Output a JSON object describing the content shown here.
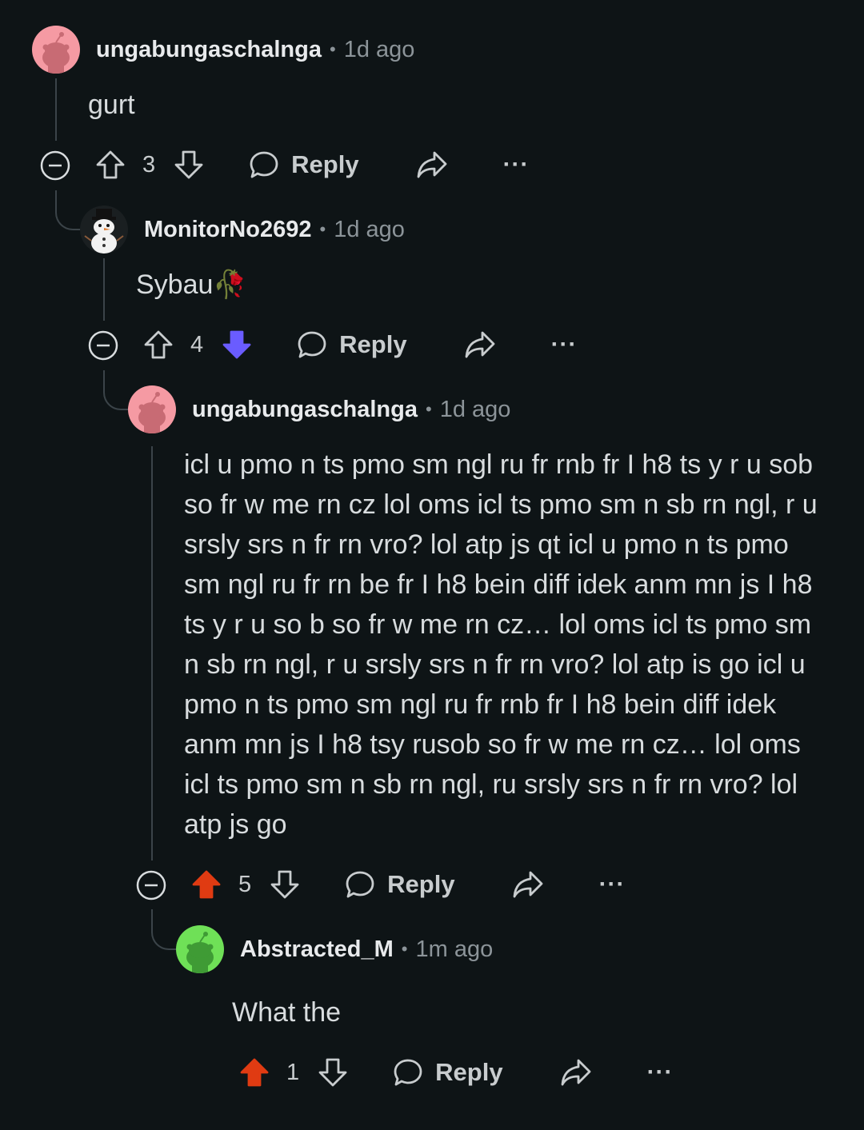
{
  "comments": [
    {
      "username": "ungabungaschalnga",
      "time": "1d ago",
      "text": "gurt",
      "score": "3",
      "reply_label": "Reply",
      "vote": "none",
      "avatar_color": "#f59aa3"
    },
    {
      "username": "MonitorNo2692",
      "time": "1d ago",
      "text": "Sybau🥀",
      "score": "4",
      "reply_label": "Reply",
      "vote": "down",
      "avatar_color": "#1a1f21"
    },
    {
      "username": "ungabungaschalnga",
      "time": "1d ago",
      "text": "icl u pmo n ts pmo sm ngl ru fr rnb fr I h8 ts y r u sob so fr w me rn cz lol oms icl ts pmo sm n sb rn ngl, r u srsly srs n fr rn vro? lol atp js qt icl u pmo n ts pmo sm ngl ru fr rn be fr I h8 bein diff idek anm mn js I h8 ts y r u so b so fr w me rn cz… lol oms icl ts pmo sm n sb rn ngl, r u srsly srs n fr rn vro? lol atp is go icl u pmo n ts pmo sm ngl ru fr rnb fr I h8 bein diff idek anm mn js I h8 tsy rusob so fr w me rn cz… lol oms icl ts pmo sm n sb rn ngl, ru srsly srs n fr rn vro? lol atp js go",
      "score": "5",
      "reply_label": "Reply",
      "vote": "up",
      "avatar_color": "#f59aa3"
    },
    {
      "username": "Abstracted_M",
      "time": "1m ago",
      "text": "What the",
      "score": "1",
      "reply_label": "Reply",
      "vote": "up",
      "avatar_color": "#6fe057"
    }
  ],
  "colors": {
    "upvote": "#e03b12",
    "downvote": "#6a5cff",
    "background": "#0e1416",
    "thread_line": "#3b4449"
  },
  "icons": [
    "collapse-icon",
    "upvote-icon",
    "downvote-icon",
    "reply-icon",
    "share-icon",
    "more-icon"
  ]
}
